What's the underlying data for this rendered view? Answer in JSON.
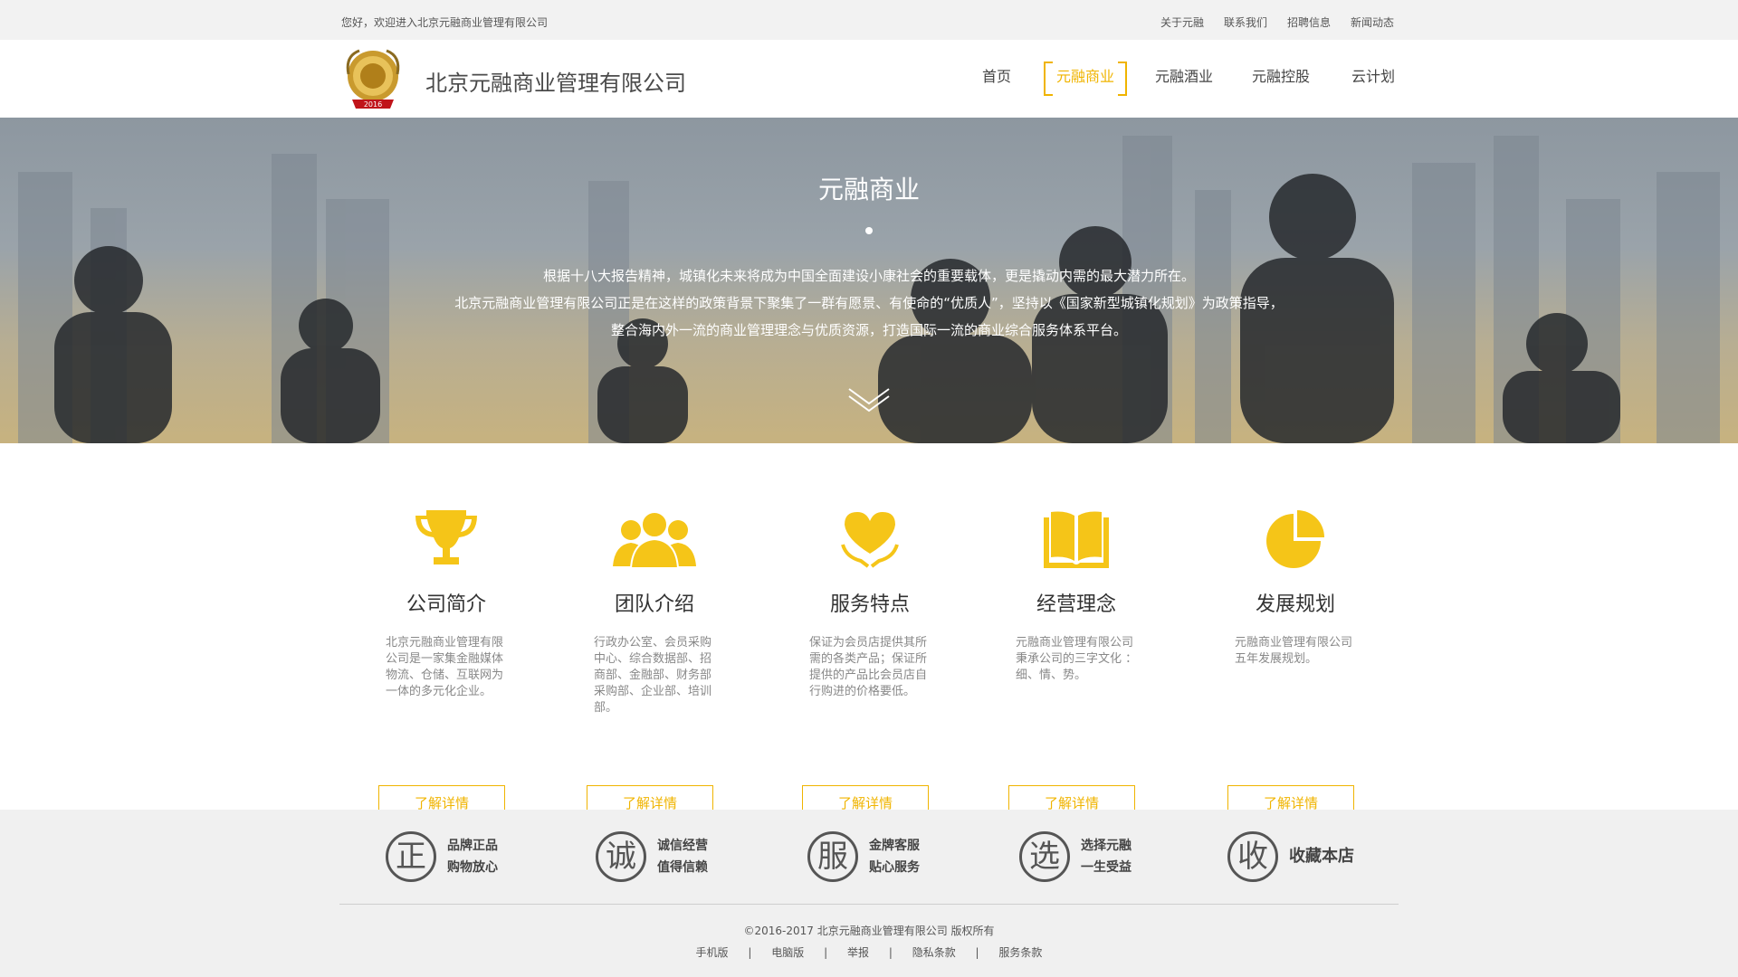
{
  "topbar": {
    "welcome": "您好，欢迎进入北京元融商业管理有限公司",
    "links": [
      "关于元融",
      "联系我们",
      "招聘信息",
      "新闻动态"
    ]
  },
  "header": {
    "logo_year": "2016",
    "company_name": "北京元融商业管理有限公司",
    "nav": [
      {
        "label": "首页",
        "active": false
      },
      {
        "label": "元融商业",
        "active": true
      },
      {
        "label": "元融酒业",
        "active": false
      },
      {
        "label": "元融控股",
        "active": false
      },
      {
        "label": "云计划",
        "active": false
      }
    ]
  },
  "hero": {
    "title": "元融商业",
    "lines": [
      "根据十八大报告精神，城镇化未来将成为中国全面建设小康社会的重要载体，更是撬动内需的最大潜力所在。",
      "北京元融商业管理有限公司正是在这样的政策背景下聚集了一群有愿景、有使命的“优质人”，坚持以《国家新型城镇化规划》为政策指导，",
      "整合海内外一流的商业管理理念与优质资源，打造国际一流的商业综合服务体系平台。"
    ]
  },
  "features": [
    {
      "icon": "trophy-icon",
      "title": "公司简介",
      "desc": "北京元融商业管理有限公司是一家集金融媒体物流、仓储、互联网为一体的多元化企业。",
      "button": "了解详情"
    },
    {
      "icon": "team-icon",
      "title": "团队介绍",
      "desc": "行政办公室、会员采购中心、综合数据部、招商部、金融部、财务部采购部、企业部、培训部。",
      "button": "了解详情"
    },
    {
      "icon": "heart-hand-icon",
      "title": "服务特点",
      "desc": "保证为会员店提供其所需的各类产品；保证所提供的产品比会员店自行购进的价格要低。",
      "button": "了解详情"
    },
    {
      "icon": "book-icon",
      "title": "经营理念",
      "desc": "元融商业管理有限公司秉承公司的三字文化 ：细、情、势。",
      "button": "了解详情"
    },
    {
      "icon": "pie-chart-icon",
      "title": "发展规划",
      "desc": "元融商业管理有限公司五年发展规划。",
      "button": "了解详情"
    }
  ],
  "promises": [
    {
      "char": "正",
      "line1": "品牌正品",
      "line2": "购物放心"
    },
    {
      "char": "诚",
      "line1": "诚信经营",
      "line2": "值得信赖"
    },
    {
      "char": "服",
      "line1": "金牌客服",
      "line2": "贴心服务"
    },
    {
      "char": "选",
      "line1": "选择元融",
      "line2": "一生受益"
    },
    {
      "char": "收",
      "line1": "收藏本店",
      "line2": ""
    }
  ],
  "footer": {
    "copyright": "©2016-2017 北京元融商业管理有限公司 版权所有",
    "links": [
      "手机版",
      "电脑版",
      "举报",
      "隐私条款",
      "服务条款"
    ],
    "separator": "|"
  },
  "colors": {
    "accent": "#f0b400",
    "icon_yellow": "#f5c518"
  }
}
